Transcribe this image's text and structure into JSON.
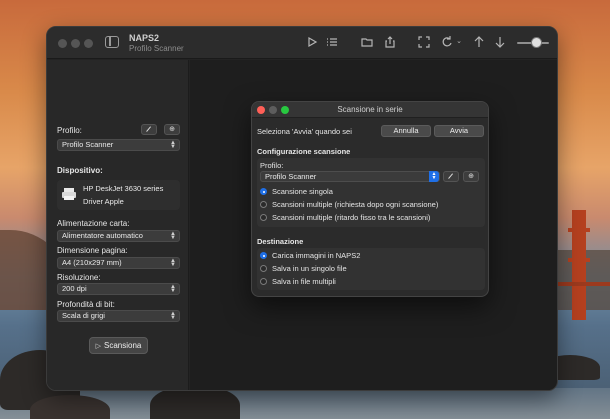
{
  "app": {
    "title": "NAPS2",
    "subtitle": "Profilo Scanner"
  },
  "toolbar": {
    "icons": [
      "play-icon",
      "list-icon",
      "folder-icon",
      "share-icon",
      "crop-icon",
      "rotate-icon",
      "arrow-up-icon",
      "arrow-down-icon",
      "zoom-slider"
    ],
    "zoom_level": 0.45
  },
  "sidebar": {
    "profile_label": "Profilo:",
    "profile_value": "Profilo Scanner",
    "device_label": "Dispositivo:",
    "device_name": "HP DeskJet 3630 series",
    "device_driver": "Driver Apple",
    "paper_source_label": "Alimentazione carta:",
    "paper_source_value": "Alimentatore automatico",
    "page_size_label": "Dimensione pagina:",
    "page_size_value": "A4 (210x297 mm)",
    "resolution_label": "Risoluzione:",
    "resolution_value": "200 dpi",
    "bit_depth_label": "Profondità di bit:",
    "bit_depth_value": "Scala di grigi",
    "scan_button": "Scansiona"
  },
  "dialog": {
    "title": "Scansione in serie",
    "instruction": "Seleziona 'Avvia' quando sei",
    "cancel_button": "Annulla",
    "start_button": "Avvia",
    "config_heading": "Configurazione scansione",
    "profile_label": "Profilo:",
    "profile_value": "Profilo Scanner",
    "scan_options": [
      {
        "label": "Scansione singola",
        "selected": true
      },
      {
        "label": "Scansioni multiple (richiesta dopo ogni scansione)",
        "selected": false
      },
      {
        "label": "Scansioni multiple (ritardo fisso tra le scansioni)",
        "selected": false
      }
    ],
    "destination_heading": "Destinazione",
    "destination_options": [
      {
        "label": "Carica immagini in NAPS2",
        "selected": true
      },
      {
        "label": "Salva in un singolo file",
        "selected": false
      },
      {
        "label": "Salva in file multipli",
        "selected": false
      }
    ]
  },
  "colors": {
    "accent": "#1f6fe6",
    "close": "#ff5f57",
    "zoom": "#28c840",
    "window_bg": "#232323"
  }
}
